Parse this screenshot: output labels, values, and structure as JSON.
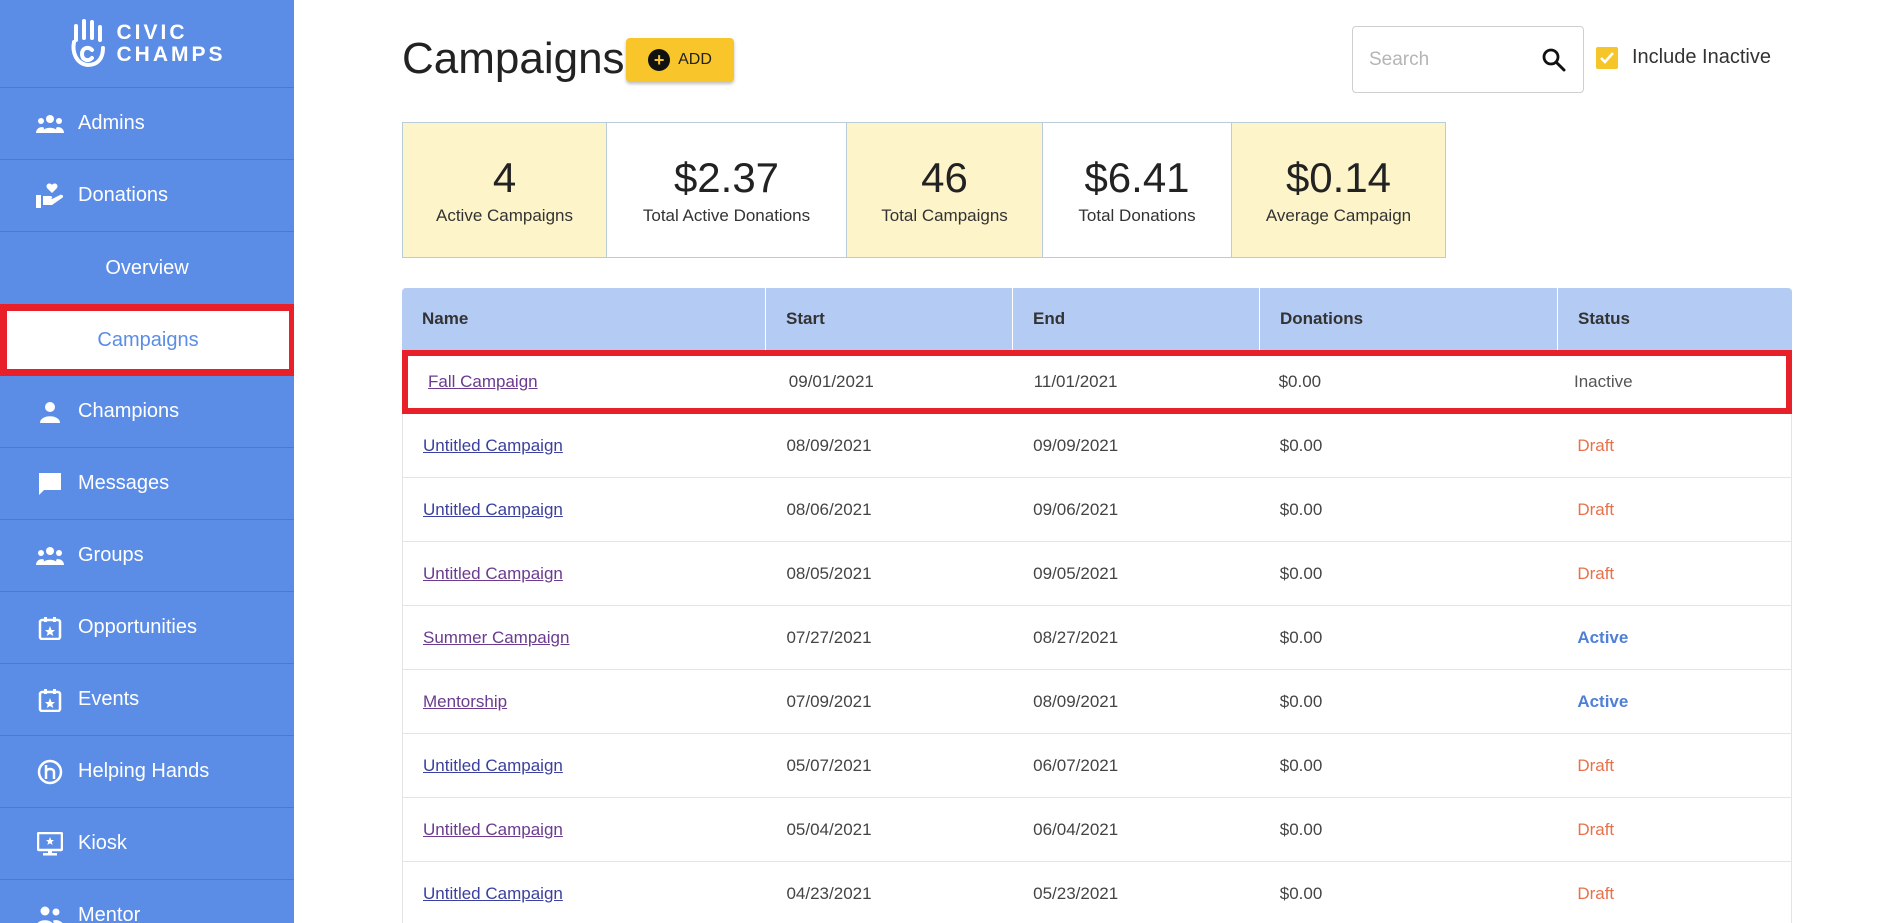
{
  "app": {
    "logo_line1": "CIVIC",
    "logo_line2": "CHAMPS"
  },
  "sidebar": {
    "items": [
      {
        "label": "Admins",
        "icon": "admins-icon"
      },
      {
        "label": "Donations",
        "icon": "donations-icon"
      },
      {
        "label": "Overview",
        "sub": true
      },
      {
        "label": "Campaigns",
        "sub": true,
        "selected": true
      },
      {
        "label": "Champions",
        "icon": "person-icon"
      },
      {
        "label": "Messages",
        "icon": "chat-icon"
      },
      {
        "label": "Groups",
        "icon": "groups-icon"
      },
      {
        "label": "Opportunities",
        "icon": "calendar-star-icon"
      },
      {
        "label": "Events",
        "icon": "calendar-star-icon"
      },
      {
        "label": "Helping Hands",
        "icon": "helping-hands-icon"
      },
      {
        "label": "Kiosk",
        "icon": "kiosk-icon"
      },
      {
        "label": "Mentor",
        "icon": "mentor-icon"
      }
    ]
  },
  "header": {
    "title": "Campaigns",
    "add_label": "ADD",
    "search_placeholder": "Search",
    "include_inactive_label": "Include Inactive",
    "include_inactive_checked": true
  },
  "stats": [
    {
      "value": "4",
      "label": "Active Campaigns"
    },
    {
      "value": "$2.37",
      "label": "Total Active Donations"
    },
    {
      "value": "46",
      "label": "Total Campaigns"
    },
    {
      "value": "$6.41",
      "label": "Total Donations"
    },
    {
      "value": "$0.14",
      "label": "Average Campaign"
    }
  ],
  "table": {
    "columns": [
      "Name",
      "Start",
      "End",
      "Donations",
      "Status"
    ],
    "rows": [
      {
        "name": "Fall Campaign",
        "start": "09/01/2021",
        "end": "11/01/2021",
        "donations": "$0.00",
        "status": "Inactive"
      },
      {
        "name": "Untitled Campaign",
        "start": "08/09/2021",
        "end": "09/09/2021",
        "donations": "$0.00",
        "status": "Draft"
      },
      {
        "name": "Untitled Campaign",
        "start": "08/06/2021",
        "end": "09/06/2021",
        "donations": "$0.00",
        "status": "Draft"
      },
      {
        "name": "Untitled Campaign",
        "start": "08/05/2021",
        "end": "09/05/2021",
        "donations": "$0.00",
        "status": "Draft"
      },
      {
        "name": "Summer Campaign",
        "start": "07/27/2021",
        "end": "08/27/2021",
        "donations": "$0.00",
        "status": "Active"
      },
      {
        "name": "Mentorship",
        "start": "07/09/2021",
        "end": "08/09/2021",
        "donations": "$0.00",
        "status": "Active"
      },
      {
        "name": "Untitled Campaign",
        "start": "05/07/2021",
        "end": "06/07/2021",
        "donations": "$0.00",
        "status": "Draft"
      },
      {
        "name": "Untitled Campaign",
        "start": "05/04/2021",
        "end": "06/04/2021",
        "donations": "$0.00",
        "status": "Draft"
      },
      {
        "name": "Untitled Campaign",
        "start": "04/23/2021",
        "end": "05/23/2021",
        "donations": "$0.00",
        "status": "Draft"
      }
    ]
  },
  "colors": {
    "sidebar": "#5b8de6",
    "accent": "#f8c62a",
    "highlight": "#e8202a",
    "draft": "#e8714a",
    "active": "#4f7fd6"
  }
}
